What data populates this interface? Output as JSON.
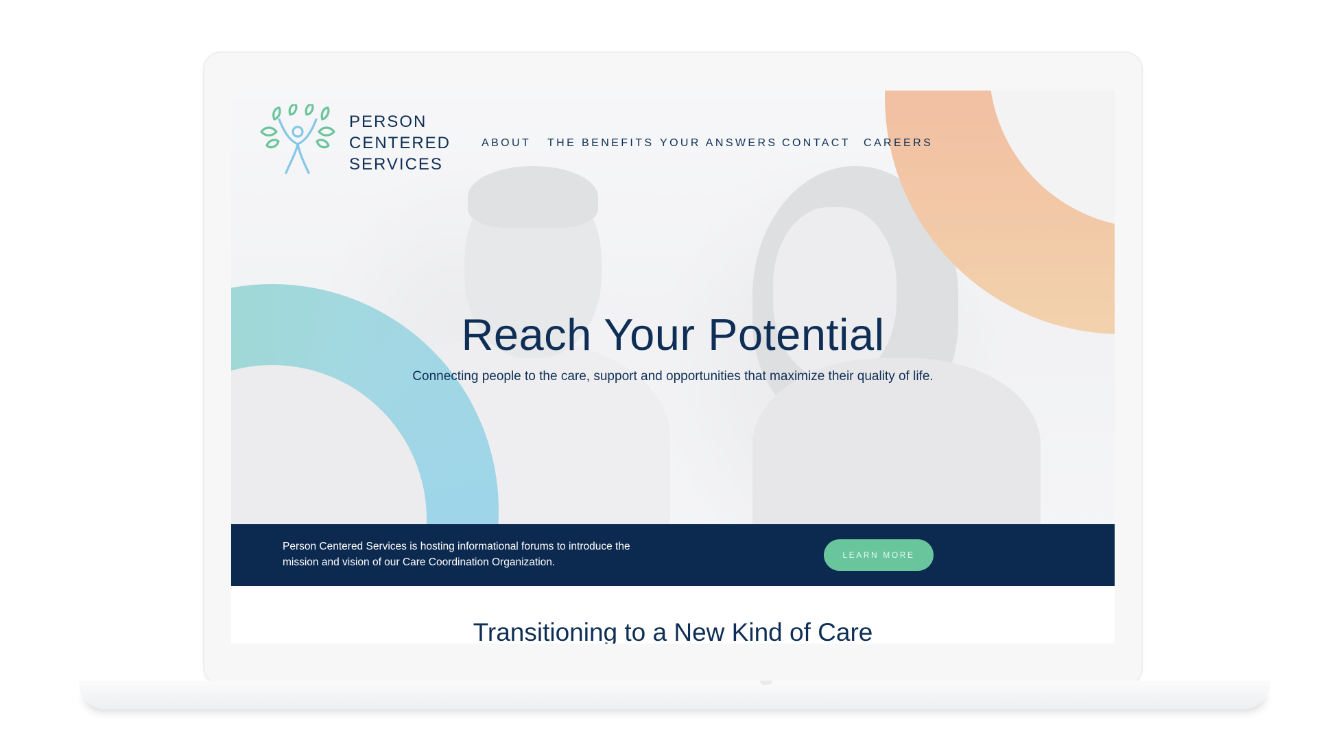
{
  "brand": {
    "lines": [
      "PERSON",
      "CENTERED",
      "SERVICES"
    ],
    "logo_icon": "tree-person-icon"
  },
  "nav": {
    "items": [
      "ABOUT",
      "THE BENEFITS",
      "YOUR ANSWERS",
      "CONTACT",
      "CAREERS"
    ]
  },
  "hero": {
    "title": "Reach Your Potential",
    "subtitle": "Connecting people to the care, support and opportunities that maximize their quality of life."
  },
  "banner": {
    "text": "Person Centered Services is hosting informational forums to introduce the mission and vision of our Care Coordination Organization.",
    "button_label": "LEARN MORE"
  },
  "section": {
    "title": "Transitioning to a New Kind of Care"
  },
  "colors": {
    "navy": "#0c2a4f",
    "text_navy": "#0e2e55",
    "green_button": "#69c69c",
    "arc_teal": "#8fd3c9",
    "arc_peach": "#f1b3a4"
  }
}
